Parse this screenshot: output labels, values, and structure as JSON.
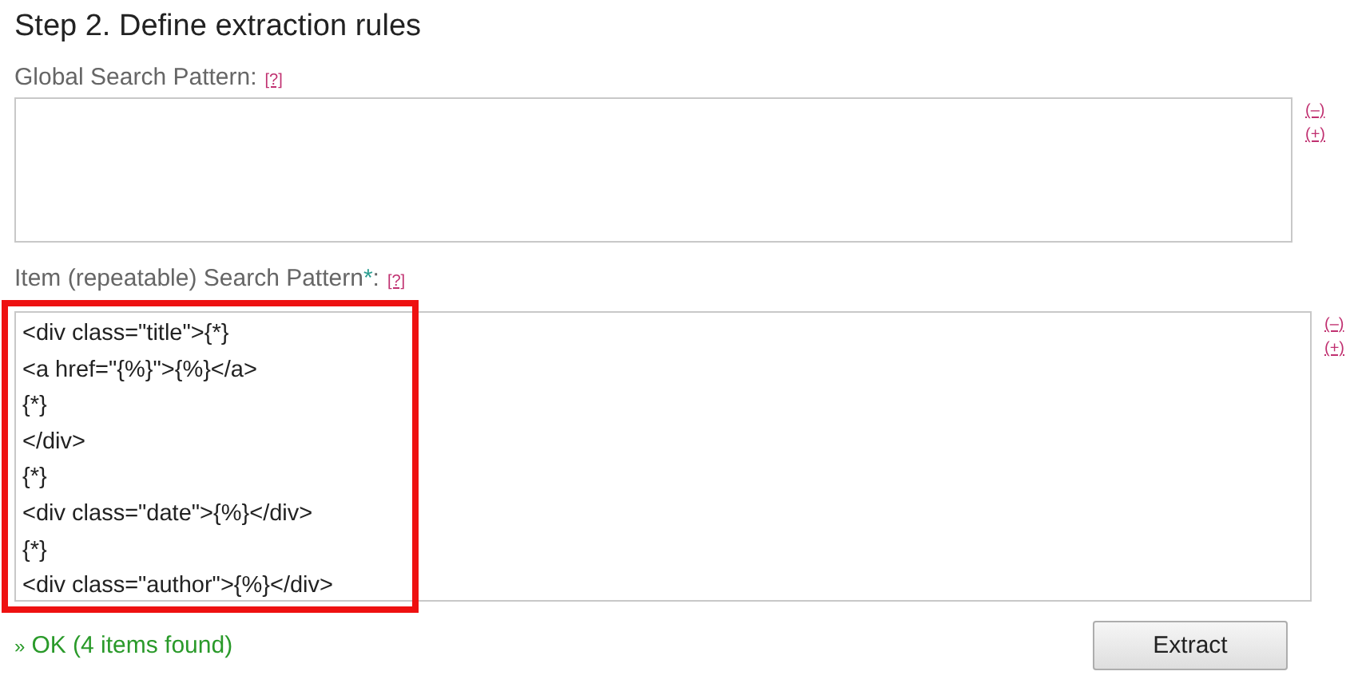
{
  "title": "Step 2. Define extraction rules",
  "patterns": [
    {
      "label": "Global Search Pattern",
      "separator": ":",
      "help": "[?]",
      "controls": [
        "(–)",
        "(+)"
      ]
    },
    {
      "label": "Item (repeatable) Search Pattern",
      "required_mark": "*",
      "separator": ":",
      "help": "[?]",
      "value": "<div class=\"title\">{*}\n<a href=\"{%}\">{%}</a>\n{*}\n</div>\n{*}\n<div class=\"date\">{%}</div>\n{*}\n<div class=\"author\">{%}</div>",
      "highlighted": true,
      "controls": [
        "(–)",
        "(+)"
      ]
    }
  ],
  "status": {
    "marker": "»",
    "text": "OK (4 items found)"
  },
  "button": "Extract"
}
